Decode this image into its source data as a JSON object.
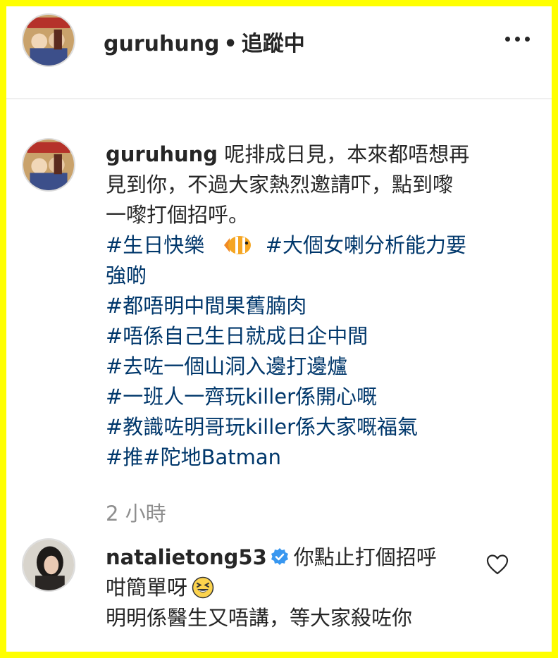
{
  "header": {
    "username": "guruhung",
    "separator": "•",
    "follow_status": "追蹤中",
    "more_icon": "more-horizontal-icon"
  },
  "caption": {
    "username": "guruhung",
    "text_lines": [
      "呢排成日見，本來都唔想再",
      "見到你，不過大家熱烈邀請吓，點到嚟",
      "一嚟打個招呼。"
    ],
    "hashtag_first": "#生日快樂",
    "emoji_icon": "tropical-fish-icon",
    "hashtag_second_line1": "#大個女喇分析能力要",
    "hashtag_second_line2": "強啲",
    "hashtags": [
      "#都唔明中間果舊腩肉",
      "#唔係自己生日就成日企中間",
      "#去咗一個山洞入邊打邊爐",
      "#一班人一齊玩killer係開心嘅",
      "#教識咗明哥玩killer係大家嘅福氣",
      "#推#陀地Batman"
    ],
    "hashtag_color": "#00376b"
  },
  "timestamp": "2 小時",
  "comment": {
    "username": "natalietong53",
    "verified_icon": "verified-badge-icon",
    "line1": "你點止打個招呼",
    "line2": "咁簡單呀",
    "emoji_icon": "grinning-squinting-face-icon",
    "line3": "明明係醫生又唔講，等大家殺咗你",
    "like_icon": "heart-outline-icon"
  },
  "colors": {
    "frame": "#ffff00",
    "text": "#262626",
    "muted": "#8e8e8e",
    "verified": "#3897f0"
  }
}
